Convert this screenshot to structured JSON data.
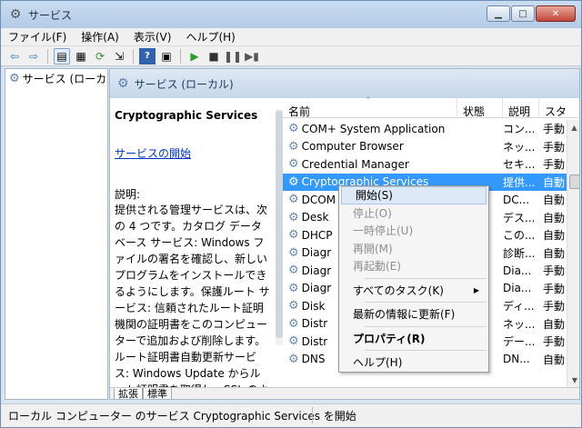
{
  "window": {
    "title": "サービス"
  },
  "menu": [
    "ファイル(F)",
    "操作(A)",
    "表示(V)",
    "ヘルプ(H)"
  ],
  "tree": {
    "item": "サービス (ローカ"
  },
  "main": {
    "header": "サービス (ローカル)",
    "detail": {
      "name": "Cryptographic Services",
      "start_link": "サービスの開始",
      "desc_label": "説明:",
      "desc": "提供される管理サービスは、次の 4 つです。カタログ データベース サービス: Windows ファイルの署名を確認し、新しいプログラムをインストールできるようにします。保護ルート サービス: 信頼されたルート証明機関の証明書をこのコンピューターで追加および削除します。ルート証明書自動更新サービス: Windows Update からルート証明書を取得し、SSL のようなシナリオを有効にします。キー サービス: 証明書用にこのコ"
    },
    "columns": [
      "名前",
      "状態",
      "説明",
      "スタ"
    ],
    "rows": [
      {
        "name": "COM+ System Application",
        "status": "",
        "desc": "コン...",
        "start": "手動"
      },
      {
        "name": "Computer Browser",
        "status": "",
        "desc": "ネッ...",
        "start": "手動"
      },
      {
        "name": "Credential Manager",
        "status": "",
        "desc": "セキ...",
        "start": "手動"
      },
      {
        "name": "Cryptographic Services",
        "status": "",
        "desc": "提供...",
        "start": "自動"
      },
      {
        "name": "DCOM",
        "status": "",
        "desc": "DC...",
        "start": "自動"
      },
      {
        "name": "Desk",
        "status": "",
        "desc": "デス...",
        "start": "自動"
      },
      {
        "name": "DHCP",
        "status": "",
        "desc": "この...",
        "start": "自動"
      },
      {
        "name": "Diagr",
        "status": "",
        "desc": "診断...",
        "start": "自動"
      },
      {
        "name": "Diagr",
        "status": "",
        "desc": "Dia...",
        "start": "手動"
      },
      {
        "name": "Diagr",
        "status": "",
        "desc": "Dia...",
        "start": "手動"
      },
      {
        "name": "Disk",
        "status": "",
        "desc": "ディ...",
        "start": "手動"
      },
      {
        "name": "Distr",
        "status": "",
        "desc": "ネッ...",
        "start": "自動"
      },
      {
        "name": "Distr",
        "status": "",
        "desc": "デー...",
        "start": "手動"
      },
      {
        "name": "DNS",
        "status": "",
        "desc": "DN...",
        "start": "自動"
      }
    ],
    "tabs": [
      "拡張",
      "標準"
    ]
  },
  "context_menu": {
    "items": [
      {
        "label": "開始(S)",
        "state": "highlighted"
      },
      {
        "label": "停止(O)",
        "state": "disabled"
      },
      {
        "label": "一時停止(U)",
        "state": "disabled"
      },
      {
        "label": "再開(M)",
        "state": "disabled"
      },
      {
        "label": "再起動(E)",
        "state": "disabled"
      },
      {
        "label": "すべてのタスク(K)",
        "state": "normal"
      },
      {
        "label": "最新の情報に更新(F)",
        "state": "normal"
      },
      {
        "label": "プロパティ(R)",
        "state": "bold"
      },
      {
        "label": "ヘルプ(H)",
        "state": "normal"
      }
    ]
  },
  "status": {
    "text": "ローカル コンピューター のサービス Cryptographic Services を開始"
  }
}
